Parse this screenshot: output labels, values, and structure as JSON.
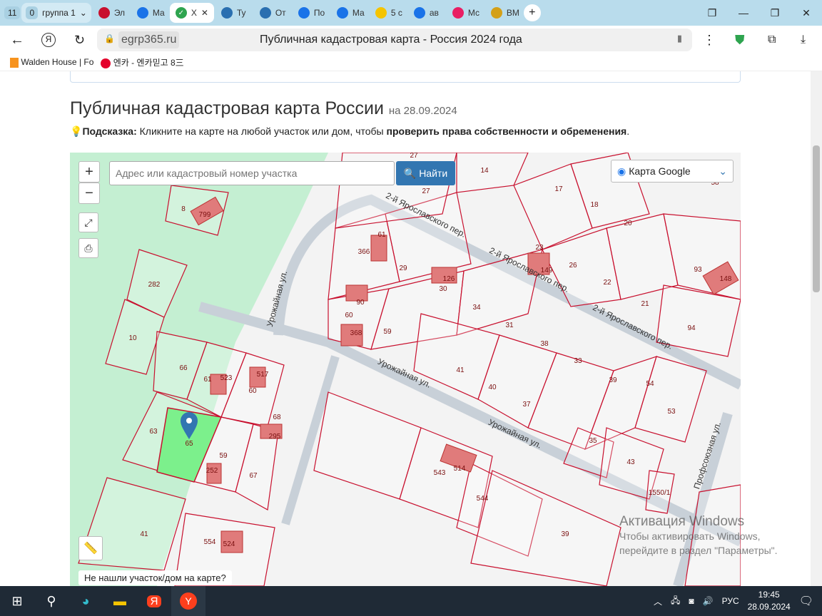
{
  "browser": {
    "tab_count": "11",
    "group": {
      "count": "0",
      "label": "группа 1"
    },
    "tabs": [
      {
        "label": "Эл",
        "color": "#c8102e"
      },
      {
        "label": "Ма",
        "color": "#1a73e8"
      },
      {
        "label": "Х",
        "color": "#2ea44f",
        "active": true
      },
      {
        "label": "Ту",
        "color": "#2a6fb0"
      },
      {
        "label": "От",
        "color": "#2a6fb0"
      },
      {
        "label": "По",
        "color": "#1a73e8"
      },
      {
        "label": "Ма",
        "color": "#1a73e8"
      },
      {
        "label": "5 с",
        "color": "#f5c400"
      },
      {
        "label": "ав",
        "color": "#1a73e8"
      },
      {
        "label": "Мс",
        "color": "#e91e63"
      },
      {
        "label": "ВМ",
        "color": "#d4a017"
      }
    ],
    "url": "egrp365.ru",
    "page_title": "Публичная кадастровая карта - Россия 2024 года",
    "bookmarks": [
      {
        "label": "Walden House | Fo"
      },
      {
        "label": "엔카 - 엔카믿고 8三"
      }
    ]
  },
  "page": {
    "title": "Публичная кадастровая карта России",
    "date": "на 28.09.2024",
    "hint_label": "Подсказка:",
    "hint_text": " Кликните на карте на любой участок или дом, чтобы ",
    "hint_bold": "проверить права собственности и обременения",
    "hint_end": "."
  },
  "map": {
    "search_placeholder": "Адрес или кадастровый номер участка",
    "find_label": "Найти",
    "layer_label": "Карта Google",
    "zoom_in": "+",
    "zoom_out": "−",
    "not_found": "Не нашли участок/дом на карте?",
    "selected_parcel": "65",
    "accent": "#3276b1",
    "parcel_color": "#c8102e",
    "selected_color": "#7cf08c",
    "parcel_labels": [
      "27",
      "14",
      "17",
      "58",
      "27",
      "8",
      "799",
      "18",
      "20",
      "61",
      "366",
      "23",
      "149",
      "26",
      "93",
      "148",
      "29",
      "126",
      "30",
      "22",
      "282",
      "21",
      "34",
      "60",
      "90",
      "31",
      "94",
      "368",
      "59",
      "10",
      "38",
      "33",
      "66",
      "61",
      "523",
      "517",
      "60",
      "41",
      "39",
      "54",
      "40",
      "53",
      "37",
      "68",
      "295",
      "63",
      "65",
      "59",
      "35",
      "252",
      "67",
      "543",
      "514",
      "43",
      "1550/1",
      "544",
      "39",
      "41",
      "554",
      "524"
    ],
    "streets": [
      "2-й Ярославского пер.",
      "2-й Ярославского пер.",
      "2-й Ярославского пер.",
      "Урожайная ул.",
      "Урожайная ул.",
      "Урожайная ул.",
      "Профсоюзная ул."
    ]
  },
  "watermark": {
    "title": "Активация Windows",
    "line1": "Чтобы активировать Windows,",
    "line2": "перейдите в раздел \"Параметры\"."
  },
  "taskbar": {
    "lang": "РУС",
    "time": "19:45",
    "date": "28.09.2024"
  }
}
